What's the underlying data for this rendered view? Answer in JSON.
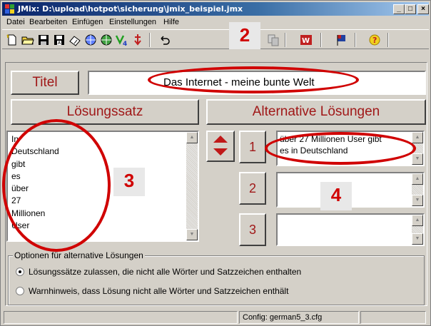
{
  "window": {
    "title": "JMix: D:\\upload\\hotpot\\sicherung\\jmix_beispiel.jmx",
    "controls": {
      "minimize": "_",
      "maximize": "□",
      "close": "×"
    }
  },
  "menu": {
    "items": [
      "Datei",
      "Bearbeiten",
      "Einfügen",
      "Einstellungen",
      "Hilfe"
    ]
  },
  "toolbar": {
    "icons": [
      "new-file-icon",
      "open-folder-icon",
      "save-icon",
      "save-as-icon",
      "clear-icon",
      "web-export-icon",
      "web-export-alt-icon",
      "v4-icon",
      "arrow-down-icon",
      "undo-icon",
      "copy-icon",
      "word-export-icon",
      "flag-icon",
      "help-icon"
    ]
  },
  "titel": {
    "label": "Titel",
    "value": "Das Internet - meine bunte Welt"
  },
  "loesungssatz": {
    "label": "Lösungssatz",
    "lines": "In\nDeutschland\ngibt\nes\nüber\n27\nMillionen\nUser"
  },
  "alternativen": {
    "label": "Alternative Lösungen",
    "items": [
      {
        "number": "1",
        "text": "über 27 Millionen User gibt\nes in Deutschland"
      },
      {
        "number": "2",
        "text": ""
      },
      {
        "number": "3",
        "text": ""
      }
    ]
  },
  "options": {
    "legend": "Optionen für alternative Lösungen",
    "radio1": "Lösungssätze zulassen, die nicht alle Wörter und Satzzeichen enthalten",
    "radio2": "Warnhinweis, dass Lösung nicht alle Wörter und Satzzeichen enthält",
    "selected": 1
  },
  "status": {
    "config": "Config: german5_3.cfg"
  },
  "annotations": {
    "label2": "2",
    "label3": "3",
    "label4": "4",
    "color": "#d00000"
  }
}
